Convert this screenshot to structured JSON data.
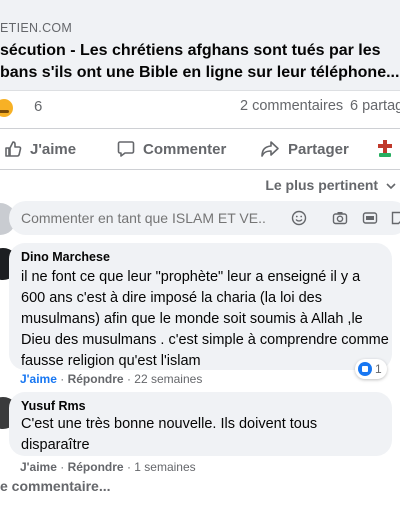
{
  "post": {
    "domain": "ETIEN.COM",
    "headline_line1": "sécution - Les chrétiens afghans sont tués par les",
    "headline_line2": "bans s'ils ont une Bible en ligne sur leur téléphone..."
  },
  "stats": {
    "reaction_count": "6",
    "comments": "2 commentaires",
    "shares": "6 partag"
  },
  "actions": {
    "like": "J'aime",
    "comment": "Commenter",
    "share": "Partager"
  },
  "sort_label": "Le plus pertinent",
  "composer": {
    "placeholder": "Commenter en tant que ISLAM ET VE..."
  },
  "comments": [
    {
      "author": "Dino Marchese",
      "lines": [
        "il ne font ce que leur \"prophète\" leur a enseigné il y a",
        "600 ans c'est à dire imposé la charia (la loi des",
        "musulmans) afin que le monde soit soumis à Allah ,le",
        "Dieu des musulmans . c'est simple à comprendre comme",
        "fausse religion qu'est l'islam"
      ],
      "like_label": "J'aime",
      "reply_label": "Répondre",
      "time": "22 semaines",
      "reaction_count": "1"
    },
    {
      "author": "Yusuf Rms",
      "lines": [
        "C'est une très bonne nouvelle. Ils doivent tous",
        "disparaître"
      ],
      "like_label": "J'aime",
      "reply_label": "Répondre",
      "time": "1 semaines"
    }
  ],
  "more_comments": "e commentaire...",
  "colors": {
    "accent": "#1877f2",
    "secondary_text": "#65676b",
    "bubble": "#f0f2f5"
  }
}
